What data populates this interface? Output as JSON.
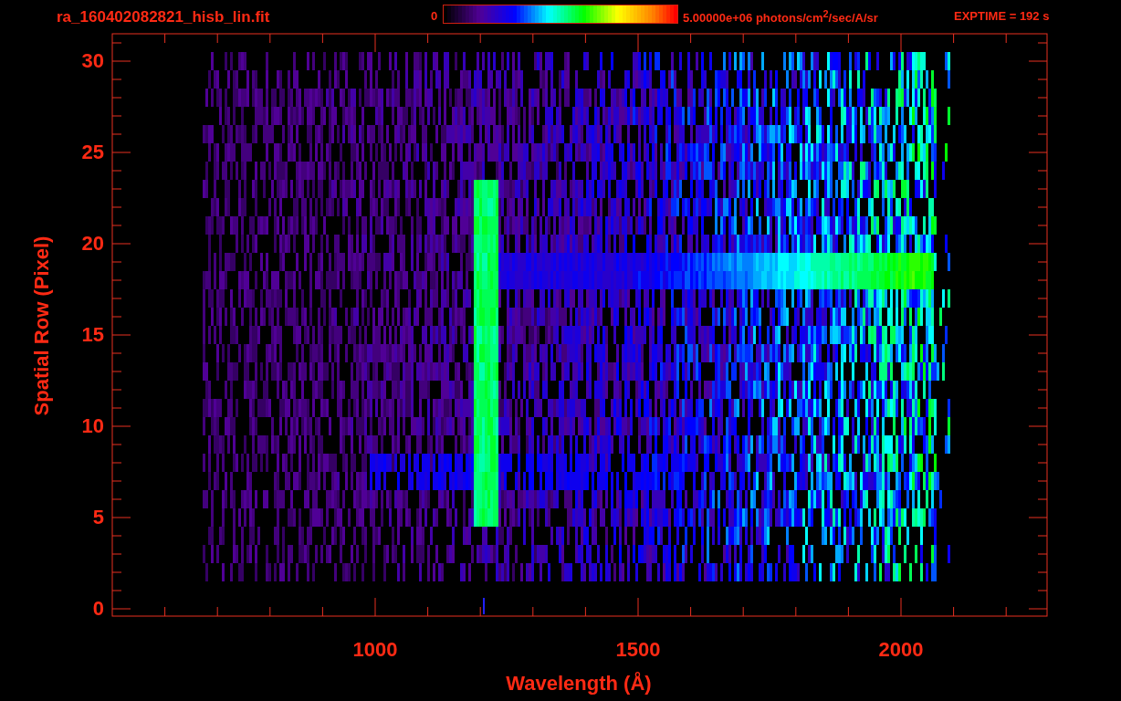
{
  "title": "ra_160402082821_hisb_lin.fit",
  "colorbar": {
    "min_label": "0",
    "max_label": "5.00000e+06 photons/cm$^{2}$/sec/A/sr"
  },
  "exposure": "EXPTIME = 192 s",
  "y_axis": {
    "label": "Spatial Row (Pixel)",
    "ticks": [
      "30",
      "25",
      "20",
      "15",
      "10",
      "5",
      "0"
    ]
  },
  "x_axis": {
    "label": "Wavelength (Å)",
    "ticks": [
      "1000",
      "1500",
      "2000"
    ]
  }
}
